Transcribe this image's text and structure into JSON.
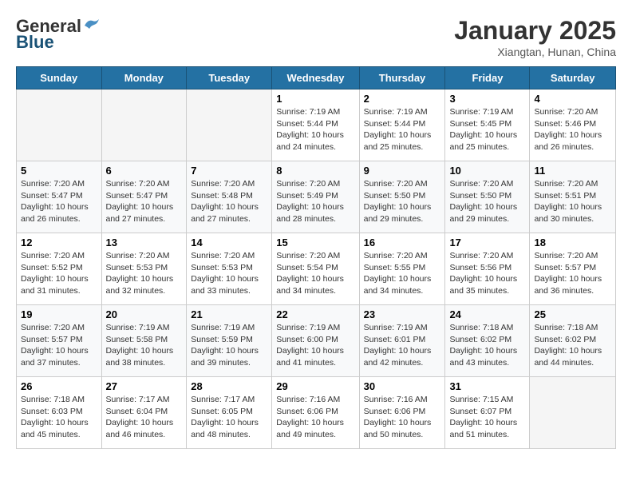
{
  "header": {
    "logo_general": "General",
    "logo_blue": "Blue",
    "month_title": "January 2025",
    "location": "Xiangtan, Hunan, China"
  },
  "weekdays": [
    "Sunday",
    "Monday",
    "Tuesday",
    "Wednesday",
    "Thursday",
    "Friday",
    "Saturday"
  ],
  "weeks": [
    [
      {
        "day": "",
        "info": ""
      },
      {
        "day": "",
        "info": ""
      },
      {
        "day": "",
        "info": ""
      },
      {
        "day": "1",
        "info": "Sunrise: 7:19 AM\nSunset: 5:44 PM\nDaylight: 10 hours\nand 24 minutes."
      },
      {
        "day": "2",
        "info": "Sunrise: 7:19 AM\nSunset: 5:44 PM\nDaylight: 10 hours\nand 25 minutes."
      },
      {
        "day": "3",
        "info": "Sunrise: 7:19 AM\nSunset: 5:45 PM\nDaylight: 10 hours\nand 25 minutes."
      },
      {
        "day": "4",
        "info": "Sunrise: 7:20 AM\nSunset: 5:46 PM\nDaylight: 10 hours\nand 26 minutes."
      }
    ],
    [
      {
        "day": "5",
        "info": "Sunrise: 7:20 AM\nSunset: 5:47 PM\nDaylight: 10 hours\nand 26 minutes."
      },
      {
        "day": "6",
        "info": "Sunrise: 7:20 AM\nSunset: 5:47 PM\nDaylight: 10 hours\nand 27 minutes."
      },
      {
        "day": "7",
        "info": "Sunrise: 7:20 AM\nSunset: 5:48 PM\nDaylight: 10 hours\nand 27 minutes."
      },
      {
        "day": "8",
        "info": "Sunrise: 7:20 AM\nSunset: 5:49 PM\nDaylight: 10 hours\nand 28 minutes."
      },
      {
        "day": "9",
        "info": "Sunrise: 7:20 AM\nSunset: 5:50 PM\nDaylight: 10 hours\nand 29 minutes."
      },
      {
        "day": "10",
        "info": "Sunrise: 7:20 AM\nSunset: 5:50 PM\nDaylight: 10 hours\nand 29 minutes."
      },
      {
        "day": "11",
        "info": "Sunrise: 7:20 AM\nSunset: 5:51 PM\nDaylight: 10 hours\nand 30 minutes."
      }
    ],
    [
      {
        "day": "12",
        "info": "Sunrise: 7:20 AM\nSunset: 5:52 PM\nDaylight: 10 hours\nand 31 minutes."
      },
      {
        "day": "13",
        "info": "Sunrise: 7:20 AM\nSunset: 5:53 PM\nDaylight: 10 hours\nand 32 minutes."
      },
      {
        "day": "14",
        "info": "Sunrise: 7:20 AM\nSunset: 5:53 PM\nDaylight: 10 hours\nand 33 minutes."
      },
      {
        "day": "15",
        "info": "Sunrise: 7:20 AM\nSunset: 5:54 PM\nDaylight: 10 hours\nand 34 minutes."
      },
      {
        "day": "16",
        "info": "Sunrise: 7:20 AM\nSunset: 5:55 PM\nDaylight: 10 hours\nand 34 minutes."
      },
      {
        "day": "17",
        "info": "Sunrise: 7:20 AM\nSunset: 5:56 PM\nDaylight: 10 hours\nand 35 minutes."
      },
      {
        "day": "18",
        "info": "Sunrise: 7:20 AM\nSunset: 5:57 PM\nDaylight: 10 hours\nand 36 minutes."
      }
    ],
    [
      {
        "day": "19",
        "info": "Sunrise: 7:20 AM\nSunset: 5:57 PM\nDaylight: 10 hours\nand 37 minutes."
      },
      {
        "day": "20",
        "info": "Sunrise: 7:19 AM\nSunset: 5:58 PM\nDaylight: 10 hours\nand 38 minutes."
      },
      {
        "day": "21",
        "info": "Sunrise: 7:19 AM\nSunset: 5:59 PM\nDaylight: 10 hours\nand 39 minutes."
      },
      {
        "day": "22",
        "info": "Sunrise: 7:19 AM\nSunset: 6:00 PM\nDaylight: 10 hours\nand 41 minutes."
      },
      {
        "day": "23",
        "info": "Sunrise: 7:19 AM\nSunset: 6:01 PM\nDaylight: 10 hours\nand 42 minutes."
      },
      {
        "day": "24",
        "info": "Sunrise: 7:18 AM\nSunset: 6:02 PM\nDaylight: 10 hours\nand 43 minutes."
      },
      {
        "day": "25",
        "info": "Sunrise: 7:18 AM\nSunset: 6:02 PM\nDaylight: 10 hours\nand 44 minutes."
      }
    ],
    [
      {
        "day": "26",
        "info": "Sunrise: 7:18 AM\nSunset: 6:03 PM\nDaylight: 10 hours\nand 45 minutes."
      },
      {
        "day": "27",
        "info": "Sunrise: 7:17 AM\nSunset: 6:04 PM\nDaylight: 10 hours\nand 46 minutes."
      },
      {
        "day": "28",
        "info": "Sunrise: 7:17 AM\nSunset: 6:05 PM\nDaylight: 10 hours\nand 48 minutes."
      },
      {
        "day": "29",
        "info": "Sunrise: 7:16 AM\nSunset: 6:06 PM\nDaylight: 10 hours\nand 49 minutes."
      },
      {
        "day": "30",
        "info": "Sunrise: 7:16 AM\nSunset: 6:06 PM\nDaylight: 10 hours\nand 50 minutes."
      },
      {
        "day": "31",
        "info": "Sunrise: 7:15 AM\nSunset: 6:07 PM\nDaylight: 10 hours\nand 51 minutes."
      },
      {
        "day": "",
        "info": ""
      }
    ]
  ]
}
